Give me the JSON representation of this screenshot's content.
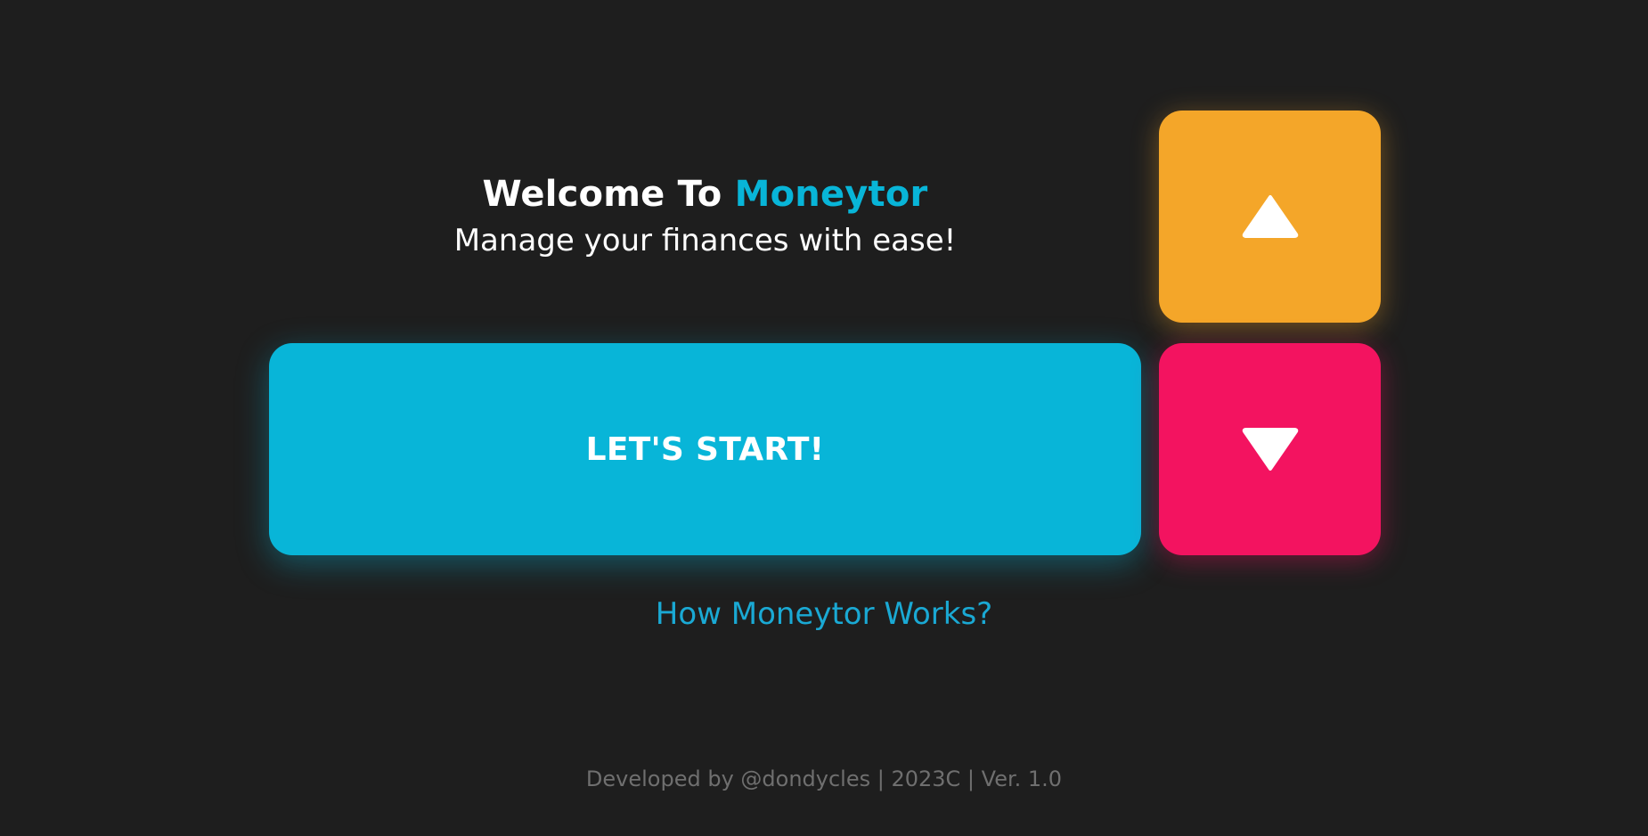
{
  "hero": {
    "title_prefix": "Welcome To",
    "title_brand": "Moneytor",
    "subtitle": "Manage your finances with ease!"
  },
  "actions": {
    "start_label": "LET'S START!",
    "how_link_label": "How Moneytor Works?",
    "up_icon": "triangle-up-icon",
    "down_icon": "triangle-down-icon"
  },
  "footer": {
    "text": "Developed by @dondycles | 2023C | Ver. 1.0"
  },
  "colors": {
    "background": "#1e1e1e",
    "brand": "#08b5d8",
    "up_button": "#f4a629",
    "down_button": "#f31360",
    "link": "#1aa9d4",
    "footer_text": "#6f6f6f"
  }
}
